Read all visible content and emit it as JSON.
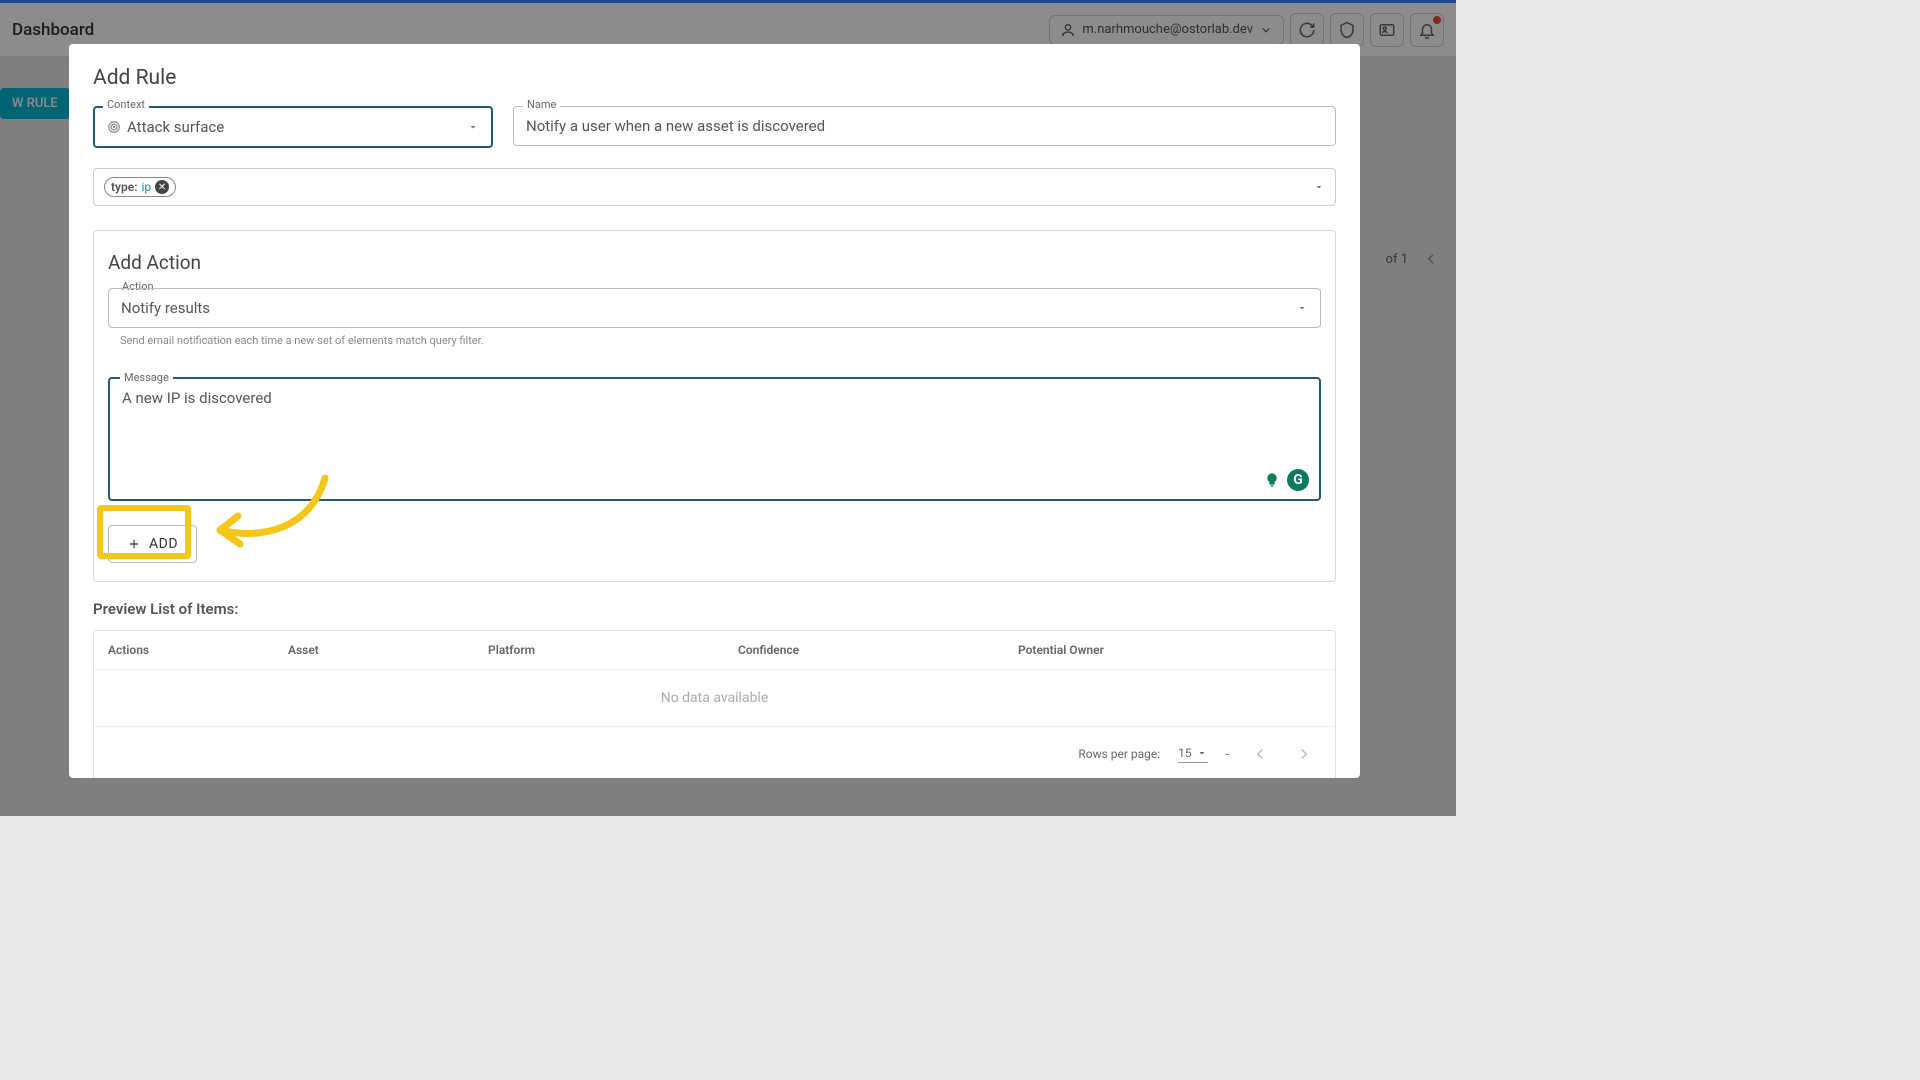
{
  "header": {
    "title": "Dashboard",
    "user_email": "m.narhmouche@ostorlab.dev"
  },
  "bg": {
    "new_rule_label": "W RULE",
    "pagination": "of 1"
  },
  "modal": {
    "title": "Add Rule",
    "context": {
      "label": "Context",
      "value": "Attack surface"
    },
    "name": {
      "label": "Name",
      "value": "Notify a user when a new asset is discovered"
    },
    "tag": {
      "key": "type:",
      "value": "ip"
    },
    "action_section_title": "Add Action",
    "action": {
      "label": "Action",
      "value": "Notify results",
      "help": "Send email notification each time a new set of elements match query filter."
    },
    "message": {
      "label": "Message",
      "value": "A new IP is discovered"
    },
    "add_button": "ADD",
    "preview_title": "Preview List of Items:",
    "table": {
      "columns": {
        "actions": "Actions",
        "asset": "Asset",
        "platform": "Platform",
        "confidence": "Confidence",
        "owner": "Potential Owner"
      },
      "empty": "No data available",
      "footer": {
        "rpp_label": "Rows per page:",
        "rpp_value": "15",
        "range": "-"
      }
    }
  }
}
